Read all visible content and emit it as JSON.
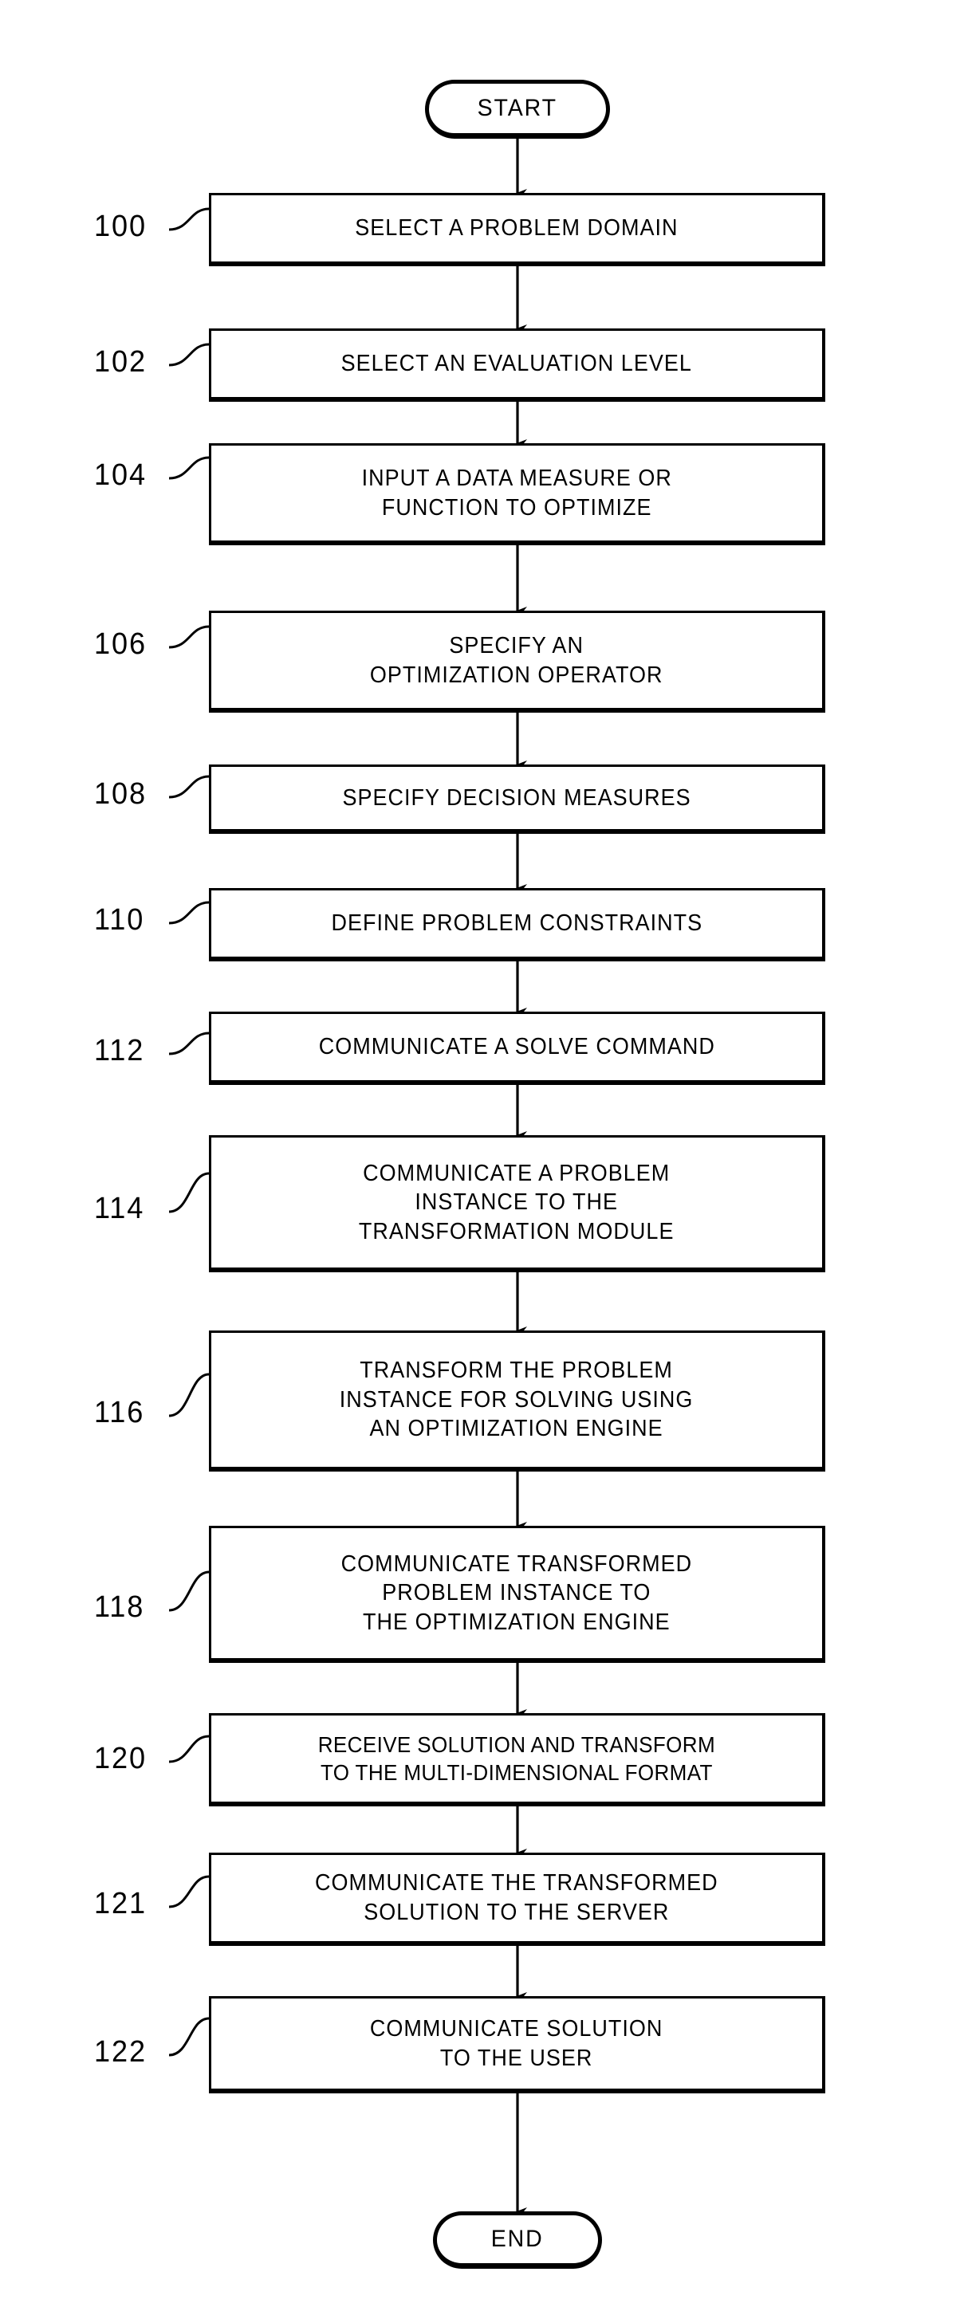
{
  "figure": {
    "type": "flowchart",
    "orientation": "vertical",
    "ink_color": "#000000",
    "background_color": "#ffffff"
  },
  "start_node": {
    "label": "START",
    "shape": "rounded-terminator"
  },
  "end_node": {
    "label": "END",
    "shape": "rounded-terminator"
  },
  "steps": [
    {
      "ref": "100",
      "label": "SELECT A PROBLEM DOMAIN"
    },
    {
      "ref": "102",
      "label": "SELECT AN EVALUATION LEVEL"
    },
    {
      "ref": "104",
      "label": "INPUT A DATA MEASURE OR\nFUNCTION TO OPTIMIZE"
    },
    {
      "ref": "106",
      "label": "SPECIFY AN\nOPTIMIZATION OPERATOR"
    },
    {
      "ref": "108",
      "label": "SPECIFY DECISION MEASURES"
    },
    {
      "ref": "110",
      "label": "DEFINE PROBLEM CONSTRAINTS"
    },
    {
      "ref": "112",
      "label": "COMMUNICATE A SOLVE COMMAND"
    },
    {
      "ref": "114",
      "label": "COMMUNICATE A PROBLEM\nINSTANCE TO THE\nTRANSFORMATION MODULE"
    },
    {
      "ref": "116",
      "label": "TRANSFORM THE PROBLEM\nINSTANCE FOR SOLVING USING\nAN OPTIMIZATION ENGINE"
    },
    {
      "ref": "118",
      "label": "COMMUNICATE TRANSFORMED\nPROBLEM INSTANCE TO\nTHE OPTIMIZATION ENGINE"
    },
    {
      "ref": "120",
      "label": "RECEIVE SOLUTION AND TRANSFORM\nTO THE MULTI-DIMENSIONAL FORMAT"
    },
    {
      "ref": "121",
      "label": "COMMUNICATE THE TRANSFORMED\nSOLUTION TO THE SERVER"
    },
    {
      "ref": "122",
      "label": "COMMUNICATE SOLUTION\nTO THE USER"
    }
  ]
}
